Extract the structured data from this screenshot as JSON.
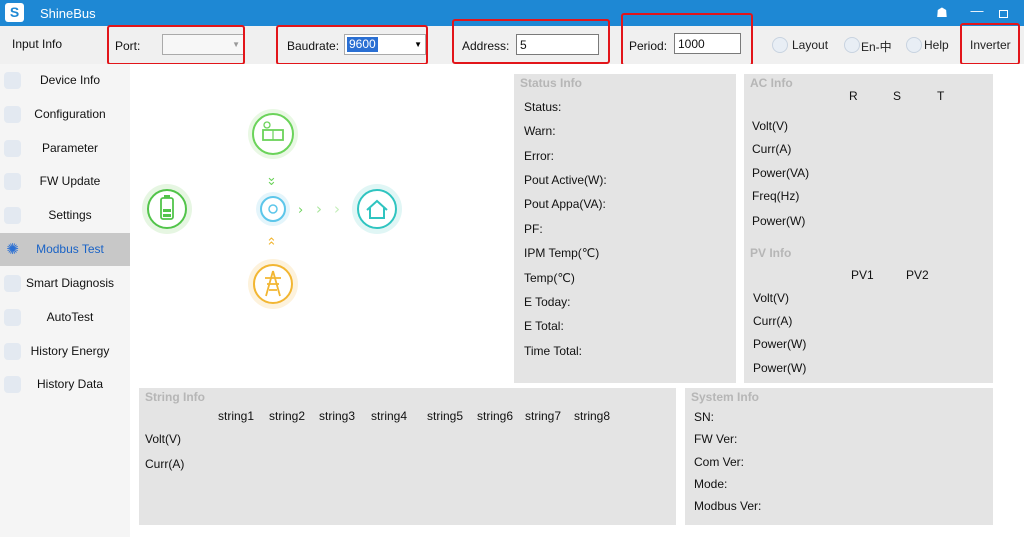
{
  "app": {
    "title": "ShineBus",
    "logo_letter": "S"
  },
  "window_icons": [
    "shirt-icon",
    "minimize-icon",
    "maximize-icon"
  ],
  "toolbar": {
    "input_info": "Input Info",
    "port_label": "Port:",
    "port_value": "",
    "baudrate_label": "Baudrate:",
    "baudrate_value": "9600",
    "address_label": "Address:",
    "address_value": "5",
    "period_label": "Period:",
    "period_value": "1000",
    "layout_label": "Layout",
    "lang_label": "En-中",
    "help_label": "Help",
    "inverter_label": "Inverter"
  },
  "sidebar": {
    "items": [
      {
        "label": "Device Info"
      },
      {
        "label": "Configuration"
      },
      {
        "label": "Parameter"
      },
      {
        "label": "FW Update"
      },
      {
        "label": "Settings"
      },
      {
        "label": "Modbus Test",
        "active": true
      },
      {
        "label": "Smart Diagnosis"
      },
      {
        "label": "AutoTest"
      },
      {
        "label": "History Energy"
      },
      {
        "label": "History Data"
      }
    ]
  },
  "status_info": {
    "title": "Status Info",
    "fields": [
      "Status:",
      "Warn:",
      "Error:",
      "Pout Active(W):",
      "Pout Appa(VA):",
      "PF:",
      "IPM Temp(℃)",
      "Temp(℃)",
      "E Today:",
      "E Total:",
      "Time Total:"
    ]
  },
  "ac_info": {
    "title": "AC Info",
    "columns": [
      "R",
      "S",
      "T"
    ],
    "rows": [
      "Volt(V)",
      "Curr(A)",
      "Power(VA)",
      "Freq(Hz)",
      "Power(W)"
    ]
  },
  "pv_info": {
    "title": "PV Info",
    "columns": [
      "PV1",
      "PV2"
    ],
    "rows": [
      "Volt(V)",
      "Curr(A)",
      "Power(W)",
      "Power(W)"
    ]
  },
  "string_info": {
    "title": "String Info",
    "columns": [
      "string1",
      "string2",
      "string3",
      "string4",
      "string5",
      "string6",
      "string7",
      "string8"
    ],
    "rows": [
      "Volt(V)",
      "Curr(A)"
    ]
  },
  "system_info": {
    "title": "System Info",
    "fields": [
      "SN:",
      "FW Ver:",
      "Com Ver:",
      "Mode:",
      "Modbus Ver:"
    ]
  },
  "colors": {
    "titlebar": "#1e88d4",
    "solar_green": "#6bd35a",
    "battery_green": "#52c44a",
    "grid_orange": "#f2b632",
    "home_teal": "#2fc4c0",
    "inverter_blue": "#5cc6ea",
    "highlight_red": "#e2151a"
  },
  "diagram_icons": [
    "solar-panel-icon",
    "battery-icon",
    "inverter-icon",
    "home-icon",
    "power-tower-icon"
  ]
}
